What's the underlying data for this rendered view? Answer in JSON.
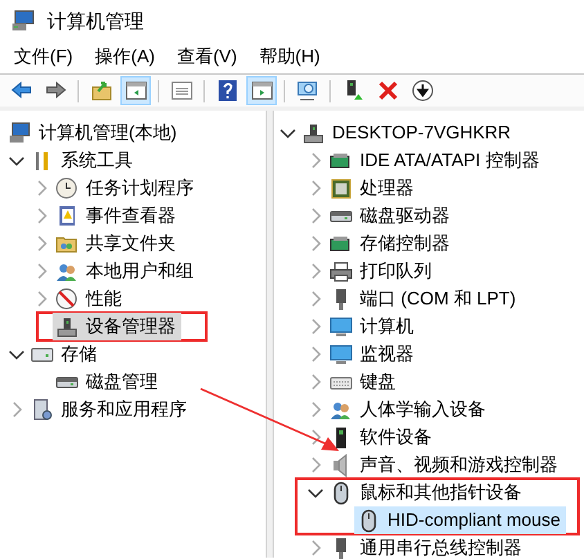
{
  "window": {
    "title": "计算机管理"
  },
  "menu": [
    "文件(F)",
    "操作(A)",
    "查看(V)",
    "帮助(H)"
  ],
  "toolbar": [
    {
      "kind": "back"
    },
    {
      "kind": "forward"
    },
    {
      "kind": "sep"
    },
    {
      "kind": "up"
    },
    {
      "kind": "pane",
      "selected": true
    },
    {
      "kind": "sep"
    },
    {
      "kind": "props",
      "selected": false
    },
    {
      "kind": "sep"
    },
    {
      "kind": "help"
    },
    {
      "kind": "pane2",
      "selected": true
    },
    {
      "kind": "sep"
    },
    {
      "kind": "scan"
    },
    {
      "kind": "sep"
    },
    {
      "kind": "enable"
    },
    {
      "kind": "remove"
    },
    {
      "kind": "download"
    }
  ],
  "left_tree": [
    {
      "label": "计算机管理(本地)",
      "kind": "computer",
      "selected": false,
      "children": [
        {
          "label": "系统工具",
          "kind": "tools",
          "expanded": true,
          "selected": false,
          "children": [
            {
              "label": "任务计划程序",
              "kind": "clock",
              "expanded": false,
              "selected": false
            },
            {
              "label": "事件查看器",
              "kind": "log",
              "expanded": false,
              "selected": false
            },
            {
              "label": "共享文件夹",
              "kind": "folder",
              "expanded": false,
              "selected": false
            },
            {
              "label": "本地用户和组",
              "kind": "users",
              "expanded": false,
              "selected": false
            },
            {
              "label": "性能",
              "kind": "gauge",
              "expanded": false,
              "selected": false
            },
            {
              "label": "设备管理器",
              "kind": "device",
              "selected": true
            }
          ]
        },
        {
          "label": "存储",
          "kind": "storage",
          "expanded": true,
          "selected": false,
          "children": [
            {
              "label": "磁盘管理",
              "kind": "disk",
              "selected": false
            }
          ]
        },
        {
          "label": "服务和应用程序",
          "kind": "services",
          "expanded": false,
          "selected": false
        }
      ]
    }
  ],
  "right_tree": [
    {
      "label": "DESKTOP-7VGHKRR",
      "kind": "device",
      "expanded": true,
      "selected": false,
      "children": [
        {
          "label": "IDE ATA/ATAPI 控制器",
          "kind": "card",
          "expanded": false,
          "selected": false
        },
        {
          "label": "处理器",
          "kind": "chip",
          "expanded": false,
          "selected": false
        },
        {
          "label": "磁盘驱动器",
          "kind": "disk",
          "expanded": false,
          "selected": false
        },
        {
          "label": "存储控制器",
          "kind": "card",
          "expanded": false,
          "selected": false
        },
        {
          "label": "打印队列",
          "kind": "printer",
          "expanded": false,
          "selected": false
        },
        {
          "label": "端口 (COM 和 LPT)",
          "kind": "port",
          "expanded": false,
          "selected": false
        },
        {
          "label": "计算机",
          "kind": "monitor",
          "expanded": false,
          "selected": false
        },
        {
          "label": "监视器",
          "kind": "monitor",
          "expanded": false,
          "selected": false
        },
        {
          "label": "键盘",
          "kind": "keyboard",
          "expanded": false,
          "selected": false
        },
        {
          "label": "人体学输入设备",
          "kind": "users",
          "expanded": false,
          "selected": false
        },
        {
          "label": "软件设备",
          "kind": "software",
          "expanded": false,
          "selected": false
        },
        {
          "label": "声音、视频和游戏控制器",
          "kind": "audio",
          "expanded": false,
          "selected": false
        },
        {
          "label": "鼠标和其他指针设备",
          "kind": "mouse",
          "expanded": true,
          "selected": false,
          "children": [
            {
              "label": "HID-compliant mouse",
              "kind": "mouse",
              "selected": true
            }
          ]
        },
        {
          "label": "通用串行总线控制器",
          "kind": "port",
          "expanded": false,
          "selected": false
        }
      ]
    }
  ]
}
